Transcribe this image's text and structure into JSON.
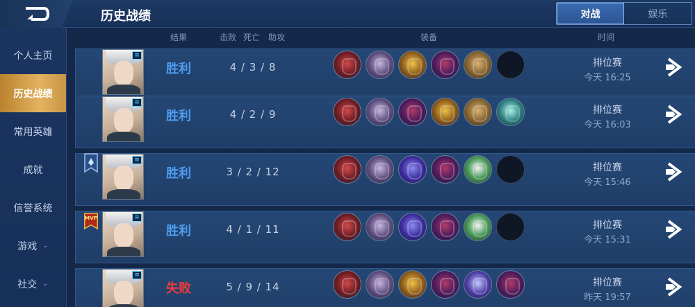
{
  "header": {
    "title": "历史战绩",
    "back_icon": "back-icon",
    "tabs": [
      {
        "label": "对战",
        "active": true
      },
      {
        "label": "娱乐",
        "active": false
      }
    ]
  },
  "sidebar": {
    "items": [
      {
        "label": "个人主页",
        "active": false,
        "chevron": false
      },
      {
        "label": "历史战绩",
        "active": true,
        "chevron": false
      },
      {
        "label": "常用英雄",
        "active": false,
        "chevron": false
      },
      {
        "label": "成就",
        "active": false,
        "chevron": false
      },
      {
        "label": "信誉系统",
        "active": false,
        "chevron": false
      },
      {
        "label": "游戏",
        "active": false,
        "chevron": true
      },
      {
        "label": "社交",
        "active": false,
        "chevron": true
      }
    ]
  },
  "columns": {
    "result": "结果",
    "kills": "击败",
    "deaths": "死亡",
    "assists": "助攻",
    "equipment": "装备",
    "time": "时间"
  },
  "matches": [
    {
      "result": "胜利",
      "win": true,
      "kda": "4 / 3 / 8",
      "mode": "排位赛",
      "time": "今天 16:25",
      "badge": "",
      "items": [
        "boots-icon",
        "skull-icon",
        "gold-icon",
        "hood-icon",
        "box-icon",
        "empty"
      ]
    },
    {
      "result": "胜利",
      "win": true,
      "kda": "4 / 2 / 9",
      "mode": "排位赛",
      "time": "今天 16:03",
      "badge": "",
      "items": [
        "boots-icon",
        "skull-icon",
        "hood-icon",
        "gold-icon",
        "box-icon",
        "crystal-icon"
      ]
    },
    {
      "result": "胜利",
      "win": true,
      "kda": "3 / 2 / 12",
      "mode": "排位赛",
      "time": "今天 15:46",
      "badge": "rank",
      "items": [
        "boots-icon",
        "skull-icon",
        "dragon-icon",
        "hood-icon",
        "card-icon",
        "empty"
      ]
    },
    {
      "result": "胜利",
      "win": true,
      "kda": "4 / 1 / 11",
      "mode": "排位赛",
      "time": "今天 15:31",
      "badge": "MVP",
      "items": [
        "boots-icon",
        "skull-icon",
        "dragon-icon",
        "hood-icon",
        "card-icon",
        "empty"
      ]
    },
    {
      "result": "失败",
      "win": false,
      "kda": "5 / 9 / 14",
      "mode": "排位赛",
      "time": "昨天 19:57",
      "badge": "",
      "items": [
        "boots-icon",
        "skull-icon",
        "gold-icon",
        "hood-icon",
        "wing-icon",
        "hood-icon"
      ]
    }
  ],
  "colors": {
    "win": "#4f9cf0",
    "lose": "#f03a3a",
    "active_sidebar": "#e3b360",
    "background": "#14284a"
  }
}
